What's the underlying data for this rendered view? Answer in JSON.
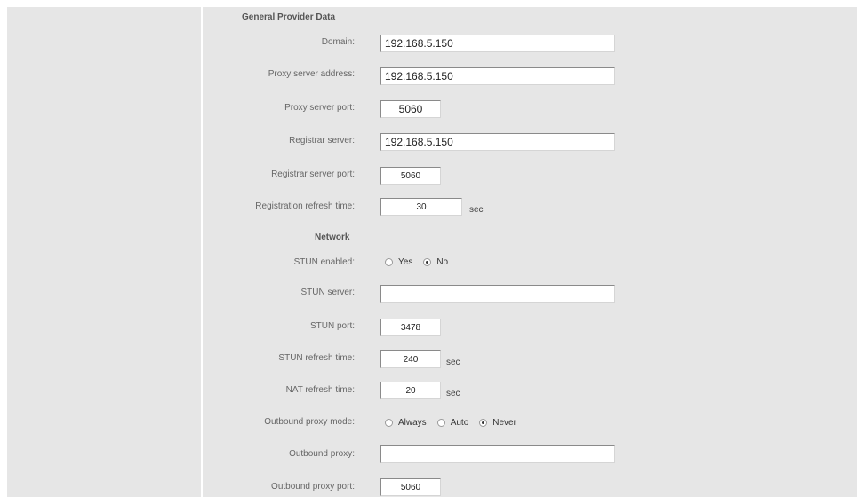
{
  "sections": {
    "general": "General Provider Data",
    "network": "Network"
  },
  "fields": {
    "domain": {
      "label": "Domain:",
      "value": "192.168.5.150"
    },
    "proxy_address": {
      "label": "Proxy server address:",
      "value": "192.168.5.150"
    },
    "proxy_port": {
      "label": "Proxy server port:",
      "value": "5060"
    },
    "registrar_server": {
      "label": "Registrar server:",
      "value": "192.168.5.150"
    },
    "registrar_port": {
      "label": "Registrar server port:",
      "value": "5060"
    },
    "registration_refresh": {
      "label": "Registration refresh time:",
      "value": "30",
      "unit": "sec"
    },
    "stun_enabled": {
      "label": "STUN enabled:",
      "options": [
        "Yes",
        "No"
      ],
      "selected": "No"
    },
    "stun_server": {
      "label": "STUN server:",
      "value": ""
    },
    "stun_port": {
      "label": "STUN port:",
      "value": "3478"
    },
    "stun_refresh": {
      "label": "STUN refresh time:",
      "value": "240",
      "unit": "sec"
    },
    "nat_refresh": {
      "label": "NAT refresh time:",
      "value": "20",
      "unit": "sec"
    },
    "outbound_mode": {
      "label": "Outbound proxy mode:",
      "options": [
        "Always",
        "Auto",
        "Never"
      ],
      "selected": "Never"
    },
    "outbound_proxy": {
      "label": "Outbound proxy:",
      "value": ""
    },
    "outbound_port": {
      "label": "Outbound proxy port:",
      "value": "5060"
    }
  }
}
